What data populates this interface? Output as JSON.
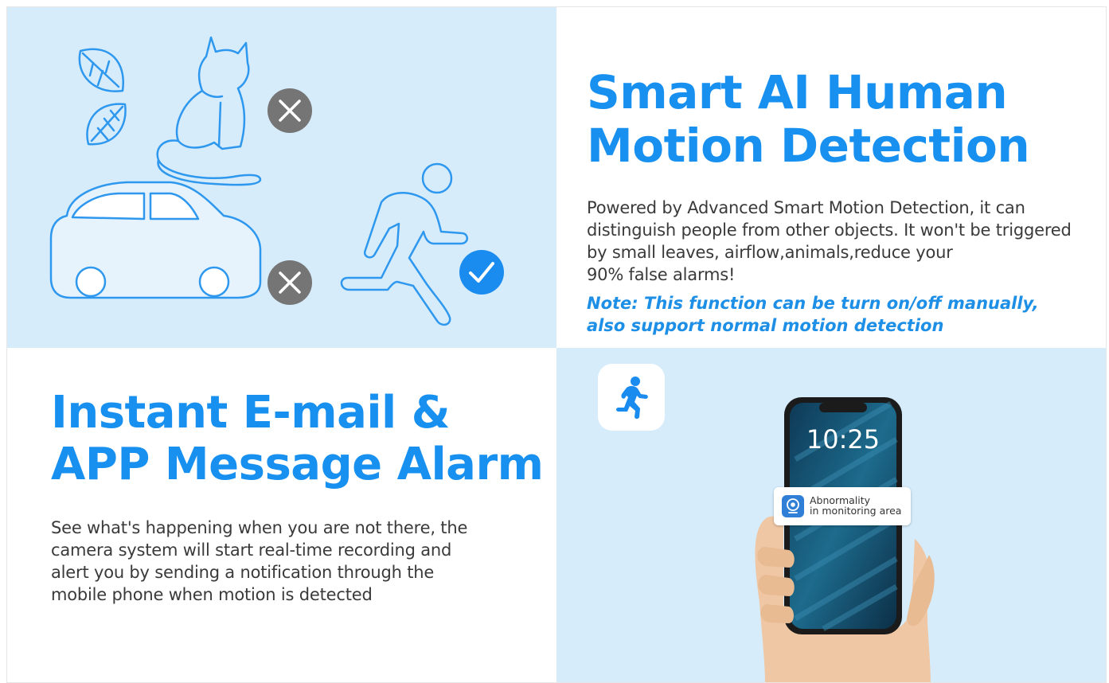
{
  "ai_panel": {
    "title_line1": "Smart AI Human",
    "title_line2": "Motion Detection",
    "body_lines": [
      "Powered by Advanced Smart Motion Detection, it can",
      "distinguish people from other objects. It won't be triggered",
      "by small leaves, airflow,animals,reduce your",
      "90% false alarms!"
    ],
    "note_line1": "Note: This function can be turn on/off manually,",
    "note_line2": "also support normal motion detection"
  },
  "alarm_panel": {
    "title_line1": "Instant E-mail &",
    "title_line2": "APP Message Alarm",
    "body_lines": [
      "See what's happening when you are not there, the",
      "camera system will start real-time recording and",
      "alert you by sending a notification through the",
      "mobile phone when motion is detected"
    ]
  },
  "phone": {
    "time": "10:25",
    "notification_line1": "Abnormality",
    "notification_line2": "in monitoring area"
  },
  "icons": {
    "rejected": "x-circle-icon",
    "accepted": "check-circle-icon",
    "motion": "running-person-icon",
    "camera": "camera-icon"
  },
  "colors": {
    "accent": "#1890f0",
    "panel_background": "#d6ecfb",
    "reject_gray": "#757575",
    "accept_blue": "#1a8cf0",
    "body_text": "#3a3a3a"
  }
}
